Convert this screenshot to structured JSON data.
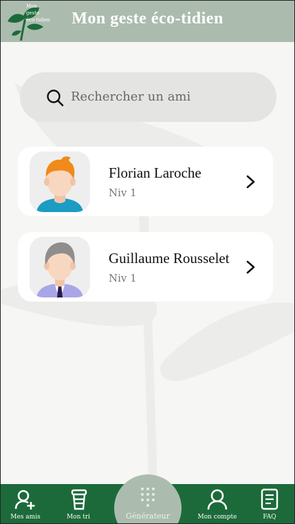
{
  "header": {
    "logo_text_lines": [
      "Mon",
      "geste",
      "éco-tidien"
    ],
    "title": "Mon geste éco-tidien"
  },
  "search": {
    "placeholder": "Rechercher un ami",
    "icon": "search-icon"
  },
  "friends": [
    {
      "name": "Florian Laroche",
      "level": "Niv 1",
      "avatar": "avatar-orange-hair"
    },
    {
      "name": "Guillaume Rousselet",
      "level": "Niv 1",
      "avatar": "avatar-grey-hair-tie"
    }
  ],
  "nav": {
    "items": [
      {
        "label": "Mes amis",
        "icon": "add-user-icon"
      },
      {
        "label": "Mon tri",
        "icon": "cup-icon"
      },
      {
        "label": "Générateur",
        "icon": "keypad-icon"
      },
      {
        "label": "Mon compte",
        "icon": "user-icon"
      },
      {
        "label": "FAQ",
        "icon": "document-icon"
      }
    ]
  },
  "colors": {
    "header_bg": "#abbcae",
    "nav_bg": "#1c6a3a",
    "page_bg": "#f6f6f5",
    "search_bg": "#e4e4e3"
  }
}
